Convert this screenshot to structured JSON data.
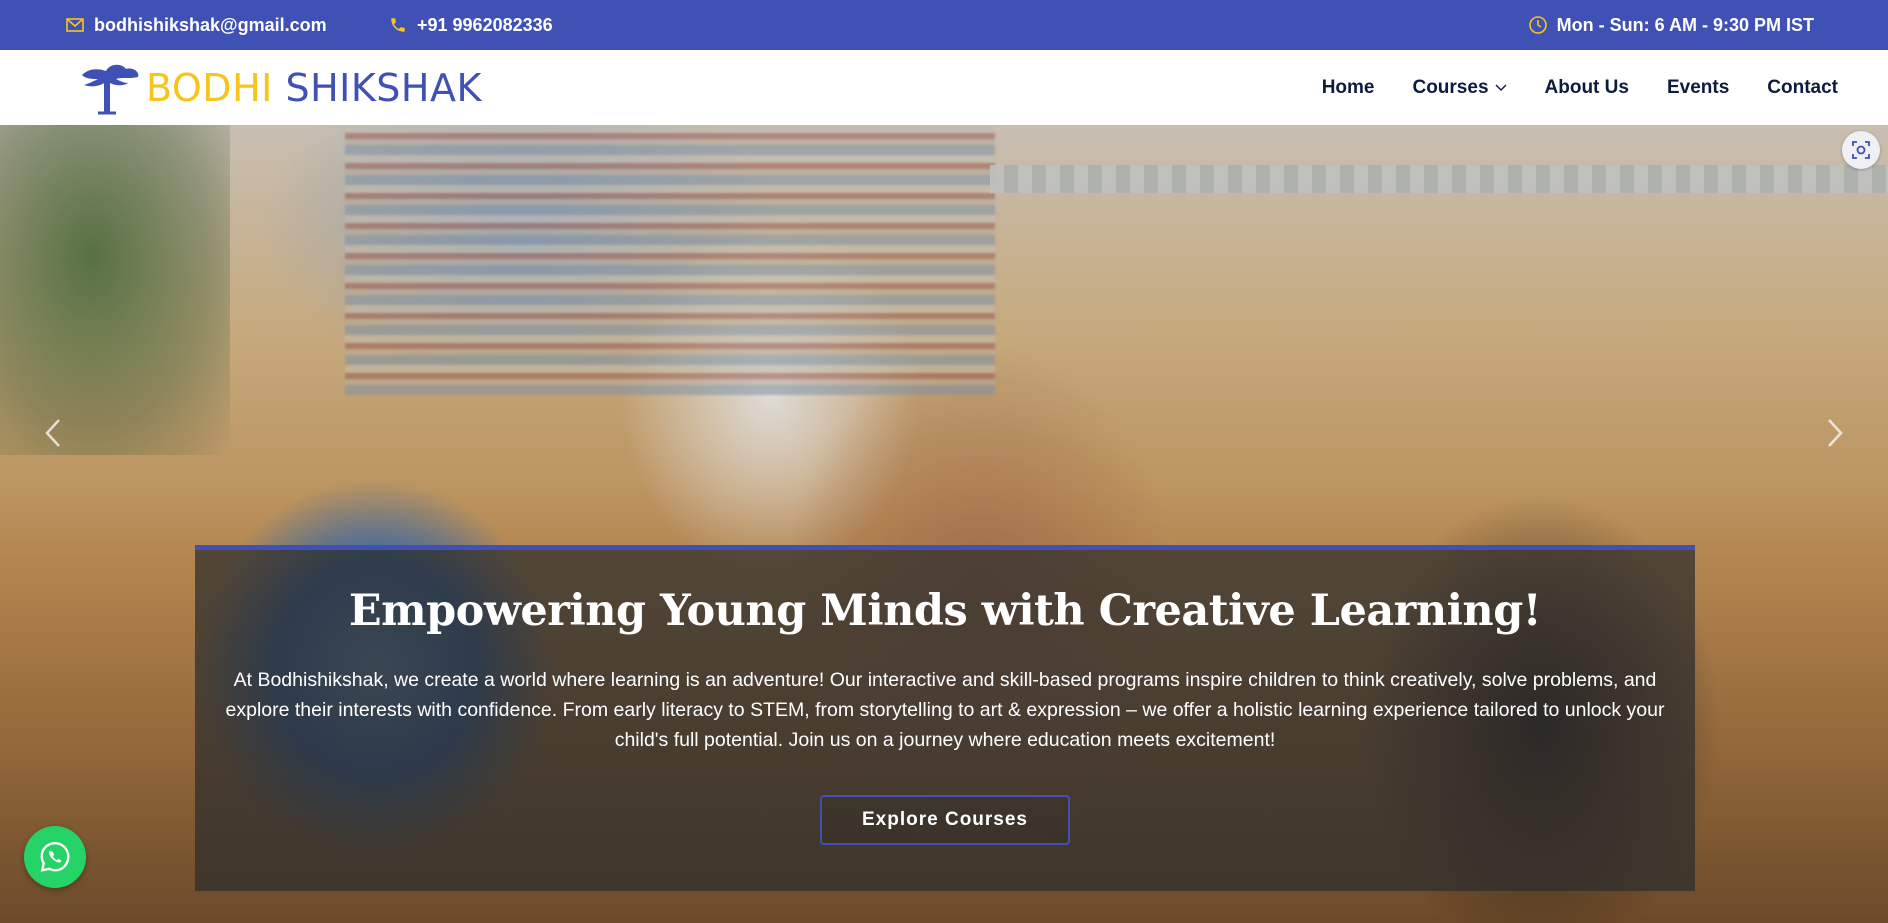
{
  "topbar": {
    "email": "bodhishikshak@gmail.com",
    "phone": "+91 9962082336",
    "hours": "Mon - Sun: 6 AM - 9:30 PM IST",
    "icons": {
      "email": "envelope-icon",
      "phone": "phone-icon",
      "hours": "clock-icon"
    }
  },
  "brand": {
    "part1": "BODHI",
    "part2": "SHIKSHAK",
    "color_primary": "#3f51b5",
    "color_accent": "#f5c51b"
  },
  "nav": {
    "items": [
      {
        "label": "Home"
      },
      {
        "label": "Courses",
        "has_dropdown": true
      },
      {
        "label": "About Us"
      },
      {
        "label": "Events"
      },
      {
        "label": "Contact"
      }
    ]
  },
  "hero": {
    "title": "Empowering Young Minds with Creative Learning!",
    "description": "At Bodhishikshak, we create a world where learning is an adventure! Our interactive and skill-based programs inspire children to think creatively, solve problems, and explore their interests with confidence. From early literacy to STEM, from storytelling to art & expression – we offer a holistic learning experience tailored to unlock your child's full potential. Join us on a journey where education meets excitement!",
    "cta_label": "Explore Courses",
    "controls": {
      "prev": "chevron-left-icon",
      "next": "chevron-right-icon",
      "capture": "screen-capture-icon"
    }
  },
  "floating": {
    "whatsapp": "whatsapp-icon",
    "whatsapp_color": "#25d366"
  }
}
